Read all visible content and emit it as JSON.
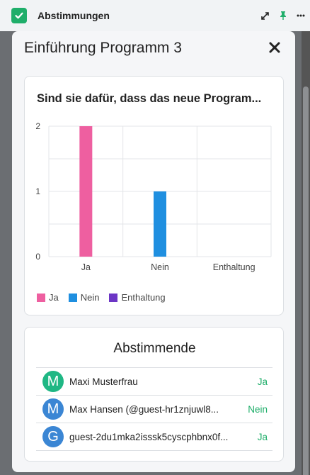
{
  "app": {
    "title": "Abstimmungen",
    "icons": [
      "check-icon",
      "expand-icon",
      "pin-icon",
      "more-icon"
    ]
  },
  "modal": {
    "title": "Einführung Programm 3",
    "close_icon": "close-icon"
  },
  "poll": {
    "question": "Sind sie dafür, dass das neue Program..."
  },
  "chart_data": {
    "type": "bar",
    "categories": [
      "Ja",
      "Nein",
      "Enthaltung"
    ],
    "values": [
      2,
      1,
      0
    ],
    "colors": [
      "#ee5fa0",
      "#1f8fe0",
      "#6c35c5"
    ],
    "ylim": [
      0,
      2
    ],
    "yticks": [
      0,
      1,
      2
    ],
    "grid": true,
    "legend": "bottom-left"
  },
  "legend": [
    {
      "label": "Ja",
      "color": "#ee5fa0"
    },
    {
      "label": "Nein",
      "color": "#1f8fe0"
    },
    {
      "label": "Enthaltung",
      "color": "#6c35c5"
    }
  ],
  "voters": {
    "title": "Abstimmende",
    "rows": [
      {
        "initial": "M",
        "name": "Maxi Musterfrau",
        "choice": "Ja",
        "avatar_color": "#1fb784"
      },
      {
        "initial": "M",
        "name": "Max Hansen (@guest-hr1znjuwl8...",
        "choice": "Nein",
        "avatar_color": "#3b86d4"
      },
      {
        "initial": "G",
        "name": "guest-2du1mka2isssk5cyscphbnx0f...",
        "choice": "Ja",
        "avatar_color": "#3b86d4"
      }
    ]
  },
  "colors": {
    "accent": "#1fae6a"
  }
}
